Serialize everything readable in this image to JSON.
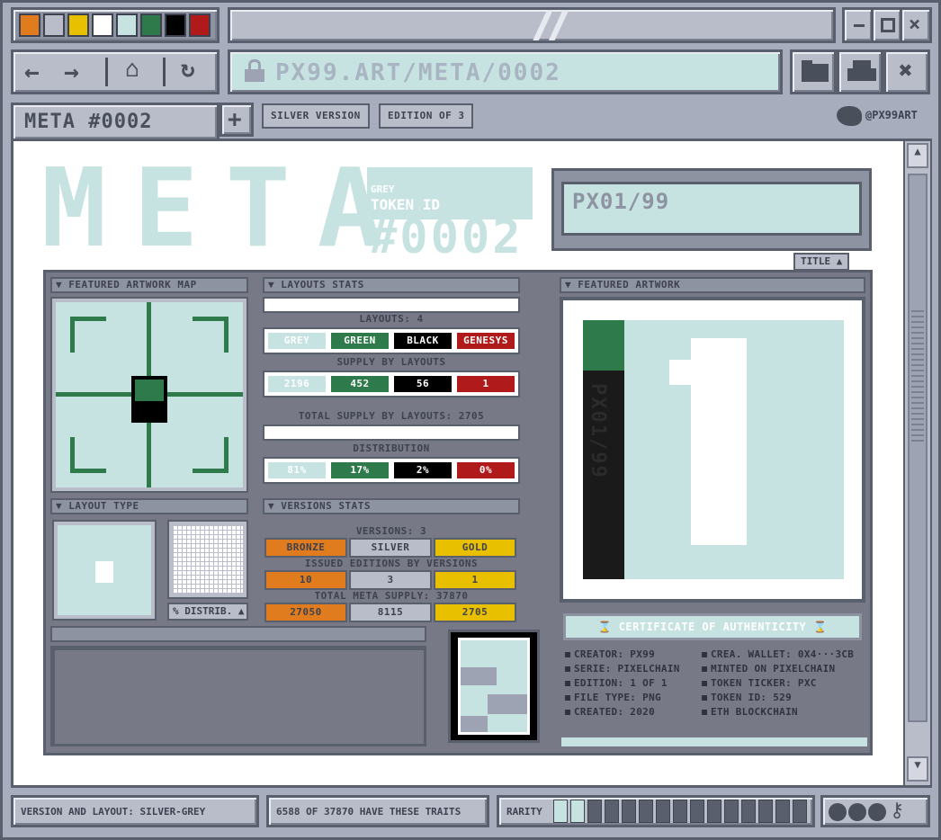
{
  "palette": [
    "#e07b1e",
    "#b9bdca",
    "#e8c000",
    "#ffffff",
    "#c6e3e1",
    "#2f7a4a",
    "#000000",
    "#b11a1a"
  ],
  "nav": {
    "back_icon": "arrow-left-icon",
    "forward_icon": "arrow-right-icon",
    "home_icon": "home-icon",
    "reload_icon": "reload-icon",
    "url": "PX99.ART/META/0002"
  },
  "tabs": {
    "active": "META #0002",
    "add": "+",
    "badges": [
      "SILVER VERSION",
      "EDITION OF 3"
    ],
    "twitter_handle": "@PX99ART"
  },
  "hero": {
    "big_word": "META",
    "number": "#0002",
    "grey_label": "GREY",
    "token_label": "TOKEN ID"
  },
  "title_box": {
    "text": "PX01/99",
    "tab": "TITLE"
  },
  "artwork_map": {
    "header": "FEATURED ARTWORK MAP"
  },
  "layout_type": {
    "header": "LAYOUT TYPE",
    "distrib_btn": "% DISTRIB."
  },
  "layouts_stats": {
    "header": "LAYOUTS STATS",
    "layouts_label": "LAYOUTS: 4",
    "names": [
      "GREY",
      "GREEN",
      "BLACK",
      "GENESYS"
    ],
    "supply_label": "SUPPLY BY LAYOUTS",
    "supply": [
      "2196",
      "452",
      "56",
      "1"
    ],
    "total_label": "TOTAL SUPPLY BY LAYOUTS: 2705",
    "distribution_label": "DISTRIBUTION",
    "distribution": [
      "81%",
      "17%",
      "2%",
      "0%"
    ]
  },
  "versions_stats": {
    "header": "VERSIONS STATS",
    "versions_label": "VERSIONS: 3",
    "names": [
      "BRONZE",
      "SILVER",
      "GOLD"
    ],
    "issued_label": "ISSUED EDITIONS BY VERSIONS",
    "issued": [
      "10",
      "3",
      "1"
    ],
    "total_label": "TOTAL META SUPPLY: 37870",
    "total": [
      "27050",
      "8115",
      "2705"
    ]
  },
  "featured": {
    "header": "FEATURED ARTWORK",
    "side_text": "PX01/99",
    "cert": "CERTIFICATE OF AUTHENTICITY",
    "left_info": [
      "CREATOR: PX99",
      "SERIE: PIXELCHAIN",
      "EDITION: 1 OF 1",
      "FILE TYPE: PNG",
      "CREATED: 2020"
    ],
    "right_info": [
      "CREA. WALLET: 0X4···3CB",
      "MINTED ON PIXELCHAIN",
      "TOKEN TICKER: PXC",
      "TOKEN ID: 529",
      "ETH BLOCKCHAIN"
    ]
  },
  "status": {
    "version_layout": "VERSION AND LAYOUT: SILVER-GREY",
    "traits": "6588 OF 37870 HAVE THESE TRAITS",
    "rarity": "RARITY",
    "rarity_level": 0.13
  }
}
